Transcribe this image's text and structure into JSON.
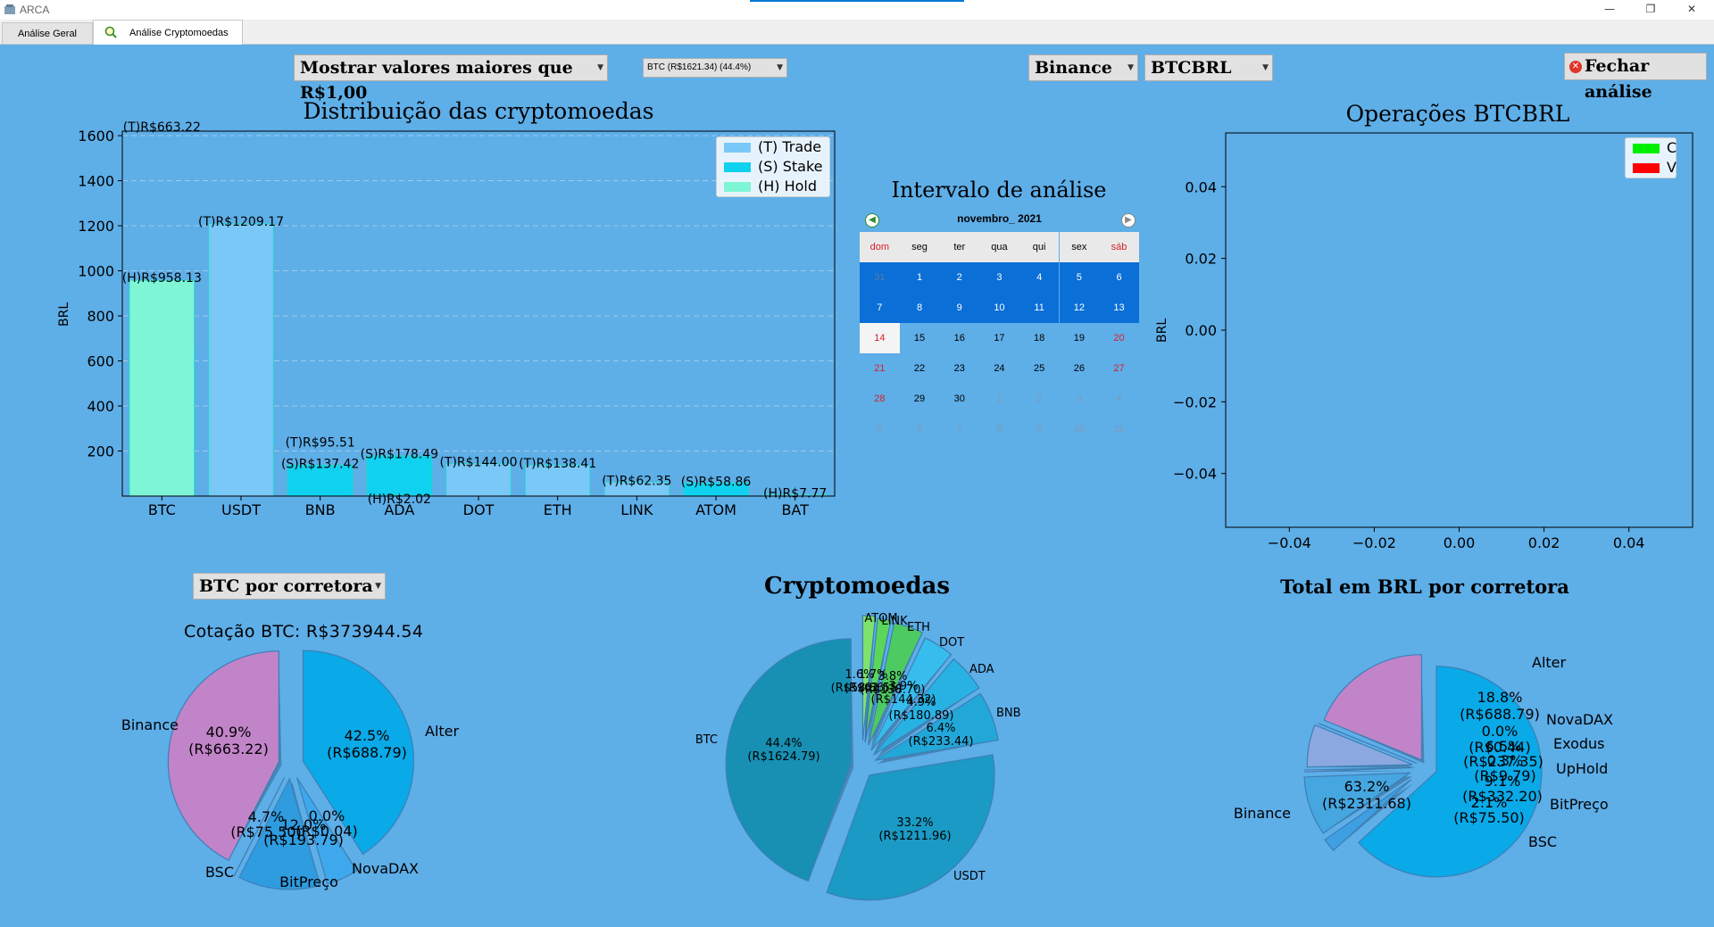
{
  "window": {
    "title": "ARCA",
    "minimize": "—",
    "restore": "❐",
    "close": "✕"
  },
  "tabs": [
    {
      "label": "Análise Geral"
    },
    {
      "label": "Análise Cryptomoedas"
    }
  ],
  "toolbar": {
    "filter_value": "Mostrar valores maiores que R$1,00",
    "coin_value": "BTC (R$1621.34) (44.4%)",
    "exchange_value": "Binance",
    "pair_value": "BTCBRL",
    "close_label": "Fechar análise"
  },
  "bar_chart": {
    "title": "Distribuição das cryptomoedas",
    "ylabel": "BRL",
    "legend": [
      {
        "label": "(T) Trade",
        "color": "#7ac8f7"
      },
      {
        "label": "(S) Stake",
        "color": "#10d2f0"
      },
      {
        "label": "(H) Hold",
        "color": "#7ef6d6"
      }
    ]
  },
  "calendar": {
    "title": "Intervalo de análise",
    "month_label": "novembro_  2021",
    "weekdays": [
      "dom",
      "seg",
      "ter",
      "qua",
      "qui",
      "sex",
      "sáb"
    ],
    "selected_day": "14",
    "weeks": [
      [
        "31",
        "1",
        "2",
        "3",
        "4",
        "5",
        "6"
      ],
      [
        "7",
        "8",
        "9",
        "10",
        "11",
        "12",
        "13"
      ],
      [
        "14",
        "15",
        "16",
        "17",
        "18",
        "19",
        "20"
      ],
      [
        "21",
        "22",
        "23",
        "24",
        "25",
        "26",
        "27"
      ],
      [
        "28",
        "29",
        "30",
        "1",
        "2",
        "3",
        "4"
      ],
      [
        "5",
        "6",
        "7",
        "8",
        "9",
        "10",
        "11"
      ]
    ]
  },
  "ops_chart": {
    "title": "Operações BTCBRL",
    "ylabel": "BRL",
    "legend": [
      {
        "label": "C",
        "color": "#00ee00"
      },
      {
        "label": "V",
        "color": "#ff0000"
      }
    ]
  },
  "broker_panel": {
    "select_value": "BTC por corretora",
    "quote": "Cotação BTC: R$373944.54"
  },
  "crypto_pie": {
    "title": "Cryptomoedas"
  },
  "total_pie": {
    "title": "Total em BRL por corretora"
  },
  "colors": {
    "background": "#5eaee8",
    "trade": "#7ac8f7",
    "stake": "#10d2f0",
    "hold": "#7ef6d6",
    "calendar_highlight": "#0a6fd6"
  },
  "chart_data": [
    {
      "type": "bar",
      "title": "Distribuição das cryptomoedas",
      "ylabel": "BRL",
      "categories": [
        "BTC",
        "USDT",
        "BNB",
        "ADA",
        "DOT",
        "ETH",
        "LINK",
        "ATOM",
        "BAT"
      ],
      "ylim": [
        0,
        1620
      ],
      "yticks": [
        200,
        400,
        600,
        800,
        1000,
        1200,
        1400,
        1600
      ],
      "series": [
        {
          "name": "(T) Trade",
          "values": [
            663.22,
            1209.17,
            95.51,
            0,
            144.0,
            138.41,
            62.35,
            0,
            7.77
          ]
        },
        {
          "name": "(S) Stake",
          "values": [
            0,
            0,
            137.42,
            178.49,
            0,
            0,
            0,
            58.86,
            0
          ]
        },
        {
          "name": "(H) Hold",
          "values": [
            958.13,
            0,
            0,
            2.02,
            0,
            0,
            0,
            0,
            0
          ]
        }
      ],
      "bar_labels": [
        {
          "cat": "BTC",
          "text": "(T)R$663.22",
          "y": 1640
        },
        {
          "cat": "BTC",
          "text": "(H)R$958.13",
          "y": 970
        },
        {
          "cat": "USDT",
          "text": "(T)R$1209.17",
          "y": 1220
        },
        {
          "cat": "BNB",
          "text": "(T)R$95.51",
          "y": 240
        },
        {
          "cat": "BNB",
          "text": "(S)R$137.42",
          "y": 145
        },
        {
          "cat": "ADA",
          "text": "(S)R$178.49",
          "y": 188
        },
        {
          "cat": "ADA",
          "text": "(H)R$2.02",
          "y": -12
        },
        {
          "cat": "DOT",
          "text": "(T)R$144.00",
          "y": 152
        },
        {
          "cat": "ETH",
          "text": "(T)R$138.41",
          "y": 146
        },
        {
          "cat": "LINK",
          "text": "(T)R$62.35",
          "y": 70
        },
        {
          "cat": "ATOM",
          "text": "(S)R$58.86",
          "y": 66
        },
        {
          "cat": "BAT",
          "text": "(H)R$7.77",
          "y": 14
        }
      ],
      "legend_position": "top-right"
    },
    {
      "type": "scatter",
      "title": "Operações BTCBRL",
      "ylabel": "BRL",
      "xlim": [
        -0.055,
        0.055
      ],
      "ylim": [
        -0.055,
        0.055
      ],
      "xticks": [
        "−0.04",
        "−0.02",
        "0.00",
        "0.02",
        "0.04"
      ],
      "yticks": [
        "0.04",
        "0.02",
        "0.00",
        "−0.02",
        "−0.04"
      ],
      "series": [
        {
          "name": "C",
          "values": []
        },
        {
          "name": "V",
          "values": []
        }
      ],
      "legend_position": "top-right"
    },
    {
      "type": "pie",
      "title": "BTC por corretora",
      "slices": [
        {
          "label": "Alter",
          "value": 688.79,
          "pct": "42.5%",
          "amount": "(R$688.79)",
          "color": "#c284c9"
        },
        {
          "label": "NovaDAX",
          "value": 0.04,
          "pct": "0.0%",
          "amount": "(R$0.04)",
          "color": "#3aa6e8"
        },
        {
          "label": "BitPreço",
          "value": 193.79,
          "pct": "12.0%",
          "amount": "(R$193.79)",
          "color": "#2f9ce0"
        },
        {
          "label": "BSC",
          "value": 75.5,
          "pct": "4.7%",
          "amount": "(R$75.50)",
          "color": "#3ea8ec"
        },
        {
          "label": "Binance",
          "value": 663.22,
          "pct": "40.9%",
          "amount": "(R$663.22)",
          "color": "#0aa9e8"
        }
      ]
    },
    {
      "type": "pie",
      "title": "Cryptomoedas",
      "slices": [
        {
          "label": "BTC",
          "value": 1624.79,
          "pct": "44.4%",
          "amount": "(R$1624.79)",
          "color": "#1790b3"
        },
        {
          "label": "USDT",
          "value": 1211.96,
          "pct": "33.2%",
          "amount": "(R$1211.96)",
          "color": "#1a9ac4"
        },
        {
          "label": "BNB",
          "value": 233.44,
          "pct": "6.4%",
          "amount": "(R$233.44)",
          "color": "#22a8d8"
        },
        {
          "label": "ADA",
          "value": 180.89,
          "pct": "4.9%",
          "amount": "(R$180.89)",
          "color": "#28b2e4"
        },
        {
          "label": "DOT",
          "value": 144.32,
          "pct": "3.9%",
          "amount": "(R$144.32)",
          "color": "#36bdee"
        },
        {
          "label": "ETH",
          "value": 138.7,
          "pct": "3.8%",
          "amount": "(R$138.70)",
          "color": "#4dca61"
        },
        {
          "label": "LINK",
          "value": 62.55,
          "pct": "1.7%",
          "amount": "(R$62.55)",
          "color": "#5ad65a"
        },
        {
          "label": "ATOM",
          "value": 58.86,
          "pct": "1.6%",
          "amount": "(R$58.86)",
          "color": "#7ee36a"
        }
      ]
    },
    {
      "type": "pie",
      "title": "Total em BRL por corretora",
      "slices": [
        {
          "label": "Alter",
          "value": 688.79,
          "pct": "18.8%",
          "amount": "(R$688.79)",
          "color": "#c284c9"
        },
        {
          "label": "NovaDAX",
          "value": 0.44,
          "pct": "0.0%",
          "amount": "(R$0.44)",
          "color": "#6fa8dc"
        },
        {
          "label": "Exodus",
          "value": 237.35,
          "pct": "6.5%",
          "amount": "(R$237.35)",
          "color": "#8ba8e0"
        },
        {
          "label": "UpHold",
          "value": 9.79,
          "pct": "0.3%",
          "amount": "(R$9.79)",
          "color": "#9bb6e6"
        },
        {
          "label": "BitPreço",
          "value": 332.2,
          "pct": "9.1%",
          "amount": "(R$332.20)",
          "color": "#46a6e0"
        },
        {
          "label": "BSC",
          "value": 75.5,
          "pct": "2.1%",
          "amount": "(R$75.50)",
          "color": "#3ea0e2"
        },
        {
          "label": "Binance",
          "value": 2311.68,
          "pct": "63.2%",
          "amount": "(R$2311.68)",
          "color": "#0aa9e8"
        }
      ]
    }
  ]
}
